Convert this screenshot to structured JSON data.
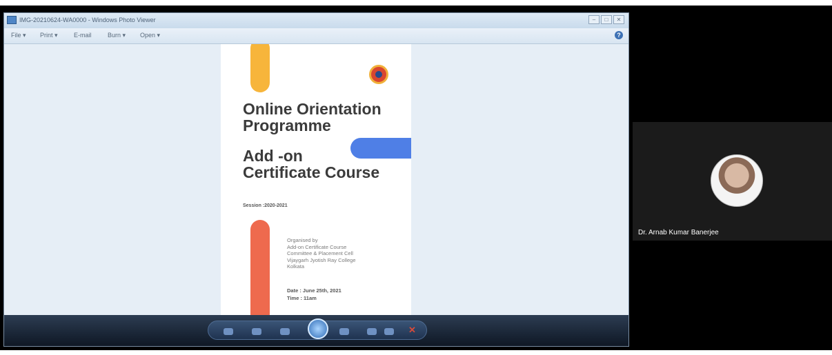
{
  "window": {
    "title": "IMG-20210624-WA0000 - Windows Photo Viewer",
    "min_label": "–",
    "max_label": "□",
    "close_label": "✕"
  },
  "menu": {
    "items": [
      "File ▾",
      "Print ▾",
      "E-mail",
      "Burn ▾",
      "Open ▾"
    ],
    "help_label": "?"
  },
  "poster": {
    "heading1": "Online Orientation Programme",
    "heading2": "Add -on Certificate Course",
    "session": "Session :2020-2021",
    "organised": [
      "Organised by",
      "Add-on Certificate Course",
      "Committee & Placement Cell",
      "Vijaygarh Jyotish Ray College",
      "Kolkata"
    ],
    "date": "Date : June 25th, 2021",
    "time": "Time : 11am",
    "colors": {
      "yellow": "#f7b53b",
      "blue": "#4f7fe6",
      "red": "#ee6a4e"
    }
  },
  "controls": {
    "items": [
      "zoom-icon",
      "fit-icon",
      "previous-icon",
      "play-slideshow-icon",
      "next-icon",
      "rotate-left-icon",
      "rotate-right-icon",
      "delete-icon"
    ],
    "delete_glyph": "✕"
  },
  "participant": {
    "name": "Dr. Arnab Kumar Banerjee"
  }
}
